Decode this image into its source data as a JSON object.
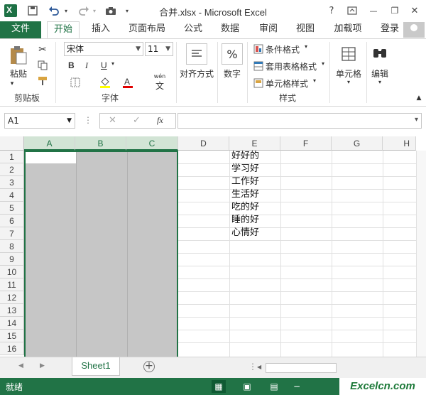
{
  "titlebar": {
    "title": "合并.xlsx - Microsoft Excel",
    "help": "?",
    "minimize": "—",
    "restore": "❐",
    "close": "✕"
  },
  "tabs": [
    {
      "label": "文件"
    },
    {
      "label": "开始"
    },
    {
      "label": "插入"
    },
    {
      "label": "页面布局"
    },
    {
      "label": "公式"
    },
    {
      "label": "数据"
    },
    {
      "label": "审阅"
    },
    {
      "label": "视图"
    },
    {
      "label": "加载项"
    }
  ],
  "login": "登录",
  "ribbon": {
    "clipboard": {
      "paste": "粘贴",
      "group": "剪贴板"
    },
    "font": {
      "name": "宋体",
      "size": "11",
      "bold": "B",
      "italic": "I",
      "underline": "U",
      "group": "字体",
      "wen": "wén",
      "wen_char": "文"
    },
    "align": {
      "label": "对齐方式"
    },
    "number": {
      "label": "数字",
      "symbol": "%"
    },
    "styles": {
      "cond": "条件格式",
      "table": "套用表格格式",
      "cell": "单元格样式",
      "group": "样式"
    },
    "cells": {
      "label": "单元格"
    },
    "edit": {
      "label": "编辑"
    }
  },
  "formula": {
    "namebox": "A1",
    "fx": "fx",
    "cancel": "✕",
    "confirm": "✓"
  },
  "columns": [
    "A",
    "B",
    "C",
    "D",
    "E",
    "F",
    "G",
    "H"
  ],
  "rows": [
    "1",
    "2",
    "3",
    "4",
    "5",
    "6",
    "7",
    "8",
    "9",
    "10",
    "11",
    "12",
    "13",
    "14",
    "15",
    "16"
  ],
  "cells": [
    "好好的",
    "学习好",
    "工作好",
    "生活好",
    "吃的好",
    "睡的好",
    "心情好"
  ],
  "sheet": {
    "name": "Sheet1",
    "add": "+"
  },
  "status": {
    "text": "就绪"
  },
  "watermark": "Excelcn.com"
}
